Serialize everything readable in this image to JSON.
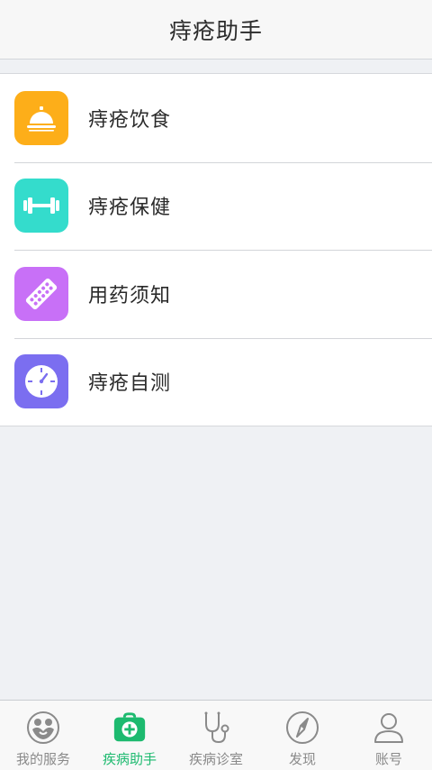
{
  "header": {
    "title": "痔疮助手"
  },
  "menu": {
    "items": [
      {
        "label": "痔疮饮食",
        "icon": "service-bell-icon",
        "color": "#fdae19"
      },
      {
        "label": "痔疮保健",
        "icon": "dumbbell-icon",
        "color": "#34dccc"
      },
      {
        "label": "用药须知",
        "icon": "pill-pack-icon",
        "color": "#c870f7"
      },
      {
        "label": "痔疮自测",
        "icon": "clock-dial-icon",
        "color": "#7b6ef0"
      }
    ]
  },
  "tabbar": {
    "active_color": "#1dba6f",
    "inactive_color": "#8a8a8a",
    "items": [
      {
        "label": "我的服务",
        "icon": "service-logo-icon",
        "active": false
      },
      {
        "label": "疾病助手",
        "icon": "medical-kit-icon",
        "active": true
      },
      {
        "label": "疾病诊室",
        "icon": "stethoscope-icon",
        "active": false
      },
      {
        "label": "发现",
        "icon": "compass-icon",
        "active": false
      },
      {
        "label": "账号",
        "icon": "user-icon",
        "active": false
      }
    ]
  }
}
